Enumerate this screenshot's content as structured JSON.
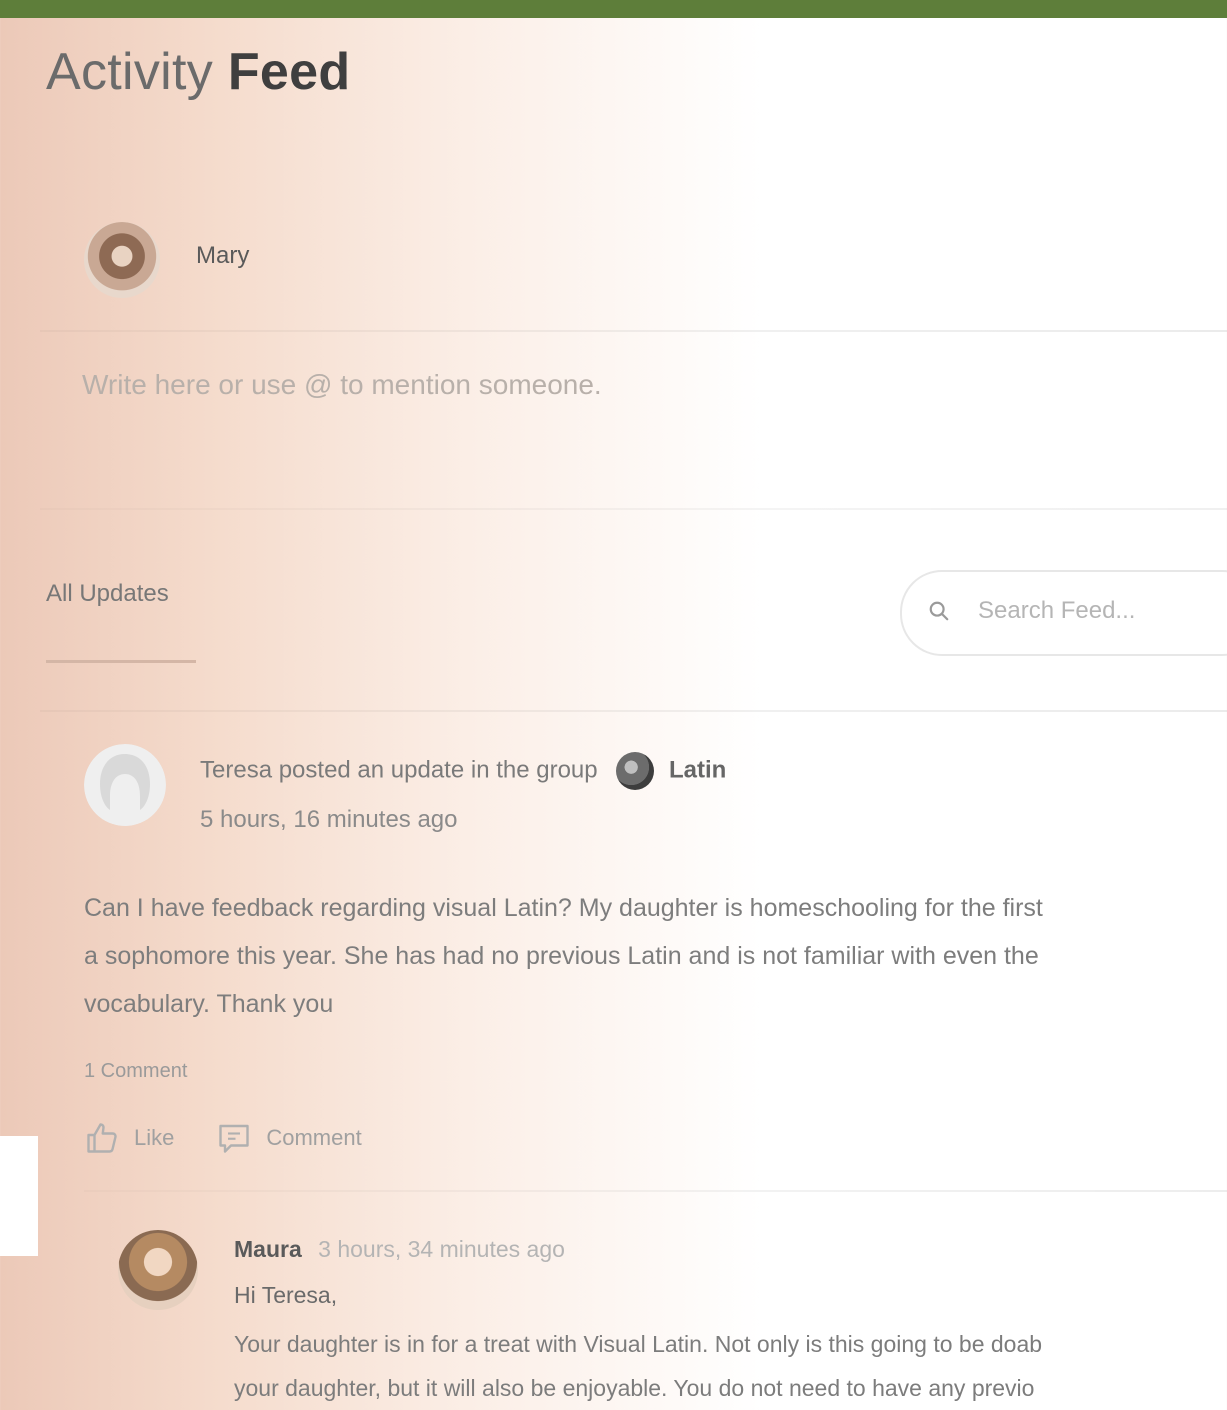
{
  "header": {
    "title_light": "Activity",
    "title_bold": "Feed"
  },
  "composer": {
    "user_name": "Mary",
    "placeholder": "Write here or use @ to mention someone."
  },
  "feed": {
    "tab_all": "All Updates",
    "search_placeholder": "Search Feed..."
  },
  "post": {
    "header_text": "Teresa posted an update in the group",
    "group_name": "Latin",
    "time": "5 hours, 16 minutes ago",
    "body_lines": [
      "Can I have feedback regarding visual Latin? My daughter is homeschooling for the first",
      "a sophomore this year. She has had no previous Latin and is not familiar with even the",
      "vocabulary. Thank you"
    ],
    "comment_count": "1 Comment",
    "like_label": "Like",
    "comment_label": "Comment"
  },
  "comment": {
    "author": "Maura",
    "time": "3 hours, 34 minutes ago",
    "greeting": "Hi Teresa,",
    "body_lines": [
      "Your daughter is in for a treat with Visual Latin.  Not only is this going to be doab",
      "your daughter, but it will also be enjoyable.  You do not need to have any previo"
    ]
  },
  "colors": {
    "topbar": "#5e7e3a",
    "accent_gradient_left": "#ecc9b8"
  }
}
